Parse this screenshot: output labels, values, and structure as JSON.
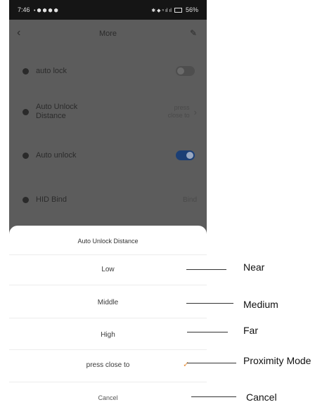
{
  "status_bar": {
    "time": "7:46",
    "left_icons": "• ⬢ ⬢ ⬢ ⬢",
    "right_icons": "✱ ◆ ⁿ ıl ıl",
    "battery": "56%"
  },
  "header": {
    "title": "More",
    "back_icon": "chevron-left-icon",
    "edit_icon": "edit-icon"
  },
  "settings": {
    "auto_lock": {
      "label": "auto lock",
      "on": false
    },
    "auto_unlock_distance": {
      "label_line1": "Auto Unlock",
      "label_line2": "Distance",
      "value_line1": "press",
      "value_line2": "close to"
    },
    "auto_unlock": {
      "label": "Auto unlock",
      "on": true
    },
    "hid_bind": {
      "label": "HID Bind",
      "value": "Bind"
    }
  },
  "sheet": {
    "title": "Auto Unlock Distance",
    "options": [
      {
        "label": "Low",
        "selected": false
      },
      {
        "label": "Middle",
        "selected": false
      },
      {
        "label": "High",
        "selected": false
      },
      {
        "label": "press close to",
        "selected": true
      }
    ],
    "cancel": "Cancel"
  },
  "annotations": {
    "low": "Near",
    "middle": "Medium",
    "high": "Far",
    "press_close_to": "Proximity Mode",
    "cancel": "Cancel"
  },
  "colors": {
    "overlay": "#5c5c5c",
    "toggle_on": "#1c3f75",
    "check": "#e8903a"
  }
}
